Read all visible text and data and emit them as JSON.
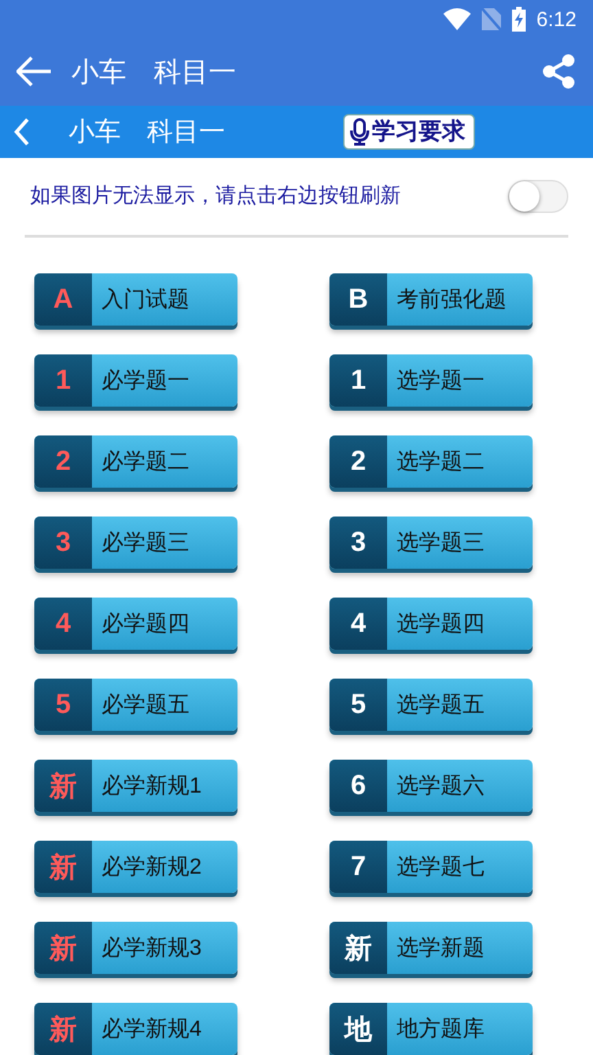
{
  "status_bar": {
    "time": "6:12"
  },
  "app_bar": {
    "title": "小车　科目一"
  },
  "sub_bar": {
    "title": "小车　科目一",
    "button": "学习要求"
  },
  "notice": {
    "text": "如果图片无法显示，请点击右边按钮刷新",
    "toggle_on": false
  },
  "buttons": [
    {
      "badge": "A",
      "label": "入门试题",
      "kind": "required"
    },
    {
      "badge": "B",
      "label": "考前强化题",
      "kind": "elective"
    },
    {
      "badge": "1",
      "label": "必学题一",
      "kind": "required"
    },
    {
      "badge": "1",
      "label": "选学题一",
      "kind": "elective"
    },
    {
      "badge": "2",
      "label": "必学题二",
      "kind": "required"
    },
    {
      "badge": "2",
      "label": "选学题二",
      "kind": "elective"
    },
    {
      "badge": "3",
      "label": "必学题三",
      "kind": "required"
    },
    {
      "badge": "3",
      "label": "选学题三",
      "kind": "elective"
    },
    {
      "badge": "4",
      "label": "必学题四",
      "kind": "required"
    },
    {
      "badge": "4",
      "label": "选学题四",
      "kind": "elective"
    },
    {
      "badge": "5",
      "label": "必学题五",
      "kind": "required"
    },
    {
      "badge": "5",
      "label": "选学题五",
      "kind": "elective"
    },
    {
      "badge": "新",
      "label": "必学新规1",
      "kind": "required"
    },
    {
      "badge": "6",
      "label": "选学题六",
      "kind": "elective"
    },
    {
      "badge": "新",
      "label": "必学新规2",
      "kind": "required"
    },
    {
      "badge": "7",
      "label": "选学题七",
      "kind": "elective"
    },
    {
      "badge": "新",
      "label": "必学新规3",
      "kind": "required"
    },
    {
      "badge": "新",
      "label": "选学新题",
      "kind": "elective"
    },
    {
      "badge": "新",
      "label": "必学新规4",
      "kind": "required"
    },
    {
      "badge": "地",
      "label": "地方题库",
      "kind": "elective"
    }
  ]
}
